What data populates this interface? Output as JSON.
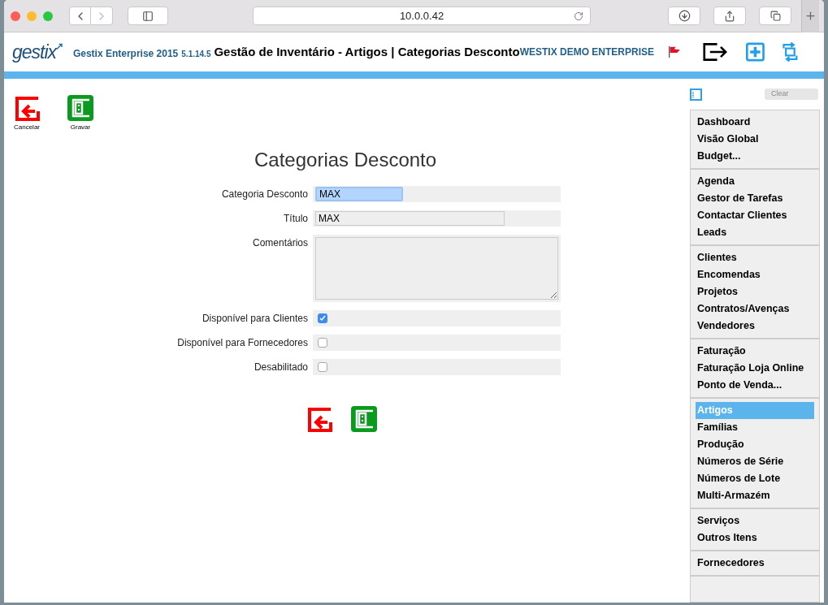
{
  "browser": {
    "url": "10.0.0.42"
  },
  "header": {
    "logo": "gestix",
    "product": "Gestix Enterprise 2015",
    "version": "5.1.14.5",
    "title": "Gestão de Inventário - Artigos | Categorias Desconto",
    "company": "WESTIX DEMO ENTERPRISE"
  },
  "actions": [
    {
      "kind": "cancel",
      "label": "Cancelar"
    },
    {
      "kind": "save",
      "label": "Gravar"
    }
  ],
  "form": {
    "title": "Categorias Desconto",
    "fields": [
      {
        "kind": "text",
        "label": "Categoria Desconto",
        "value": "MAX",
        "focused": true
      },
      {
        "kind": "text",
        "label": "Título",
        "value": "MAX",
        "focused": false
      },
      {
        "kind": "textarea",
        "label": "Comentários"
      },
      {
        "kind": "checkbox",
        "label": "Disponível para Clientes",
        "checked": true
      },
      {
        "kind": "checkbox",
        "label": "Disponível para Fornecedores",
        "checked": false
      },
      {
        "kind": "checkbox",
        "label": "Desabilitado",
        "checked": false
      }
    ],
    "bottom_actions": [
      {
        "kind": "cancel"
      },
      {
        "kind": "save"
      }
    ]
  },
  "sidebar": {
    "filter": "Clear",
    "groups": [
      [
        {
          "label": "Dashboard",
          "selected": false
        },
        {
          "label": "Visão Global",
          "selected": false
        },
        {
          "label": "Budget...",
          "selected": false
        }
      ],
      [
        {
          "label": "Agenda",
          "selected": false
        },
        {
          "label": "Gestor de Tarefas",
          "selected": false
        },
        {
          "label": "Contactar Clientes",
          "selected": false
        },
        {
          "label": "Leads",
          "selected": false
        }
      ],
      [
        {
          "label": "Clientes",
          "selected": false
        },
        {
          "label": "Encomendas",
          "selected": false
        },
        {
          "label": "Projetos",
          "selected": false
        },
        {
          "label": "Contratos/Avenças",
          "selected": false
        },
        {
          "label": "Vendedores",
          "selected": false
        }
      ],
      [
        {
          "label": "Faturação",
          "selected": false
        },
        {
          "label": "Faturação Loja Online",
          "selected": false
        },
        {
          "label": "Ponto de Venda...",
          "selected": false
        }
      ],
      [
        {
          "label": "Artigos",
          "selected": true
        },
        {
          "label": "Famílias",
          "selected": false
        },
        {
          "label": "Produção",
          "selected": false
        },
        {
          "label": "Números de Série",
          "selected": false
        },
        {
          "label": "Números de Lote",
          "selected": false
        },
        {
          "label": "Multi-Armazém",
          "selected": false
        }
      ],
      [
        {
          "label": "Serviços",
          "selected": false
        },
        {
          "label": "Outros Itens",
          "selected": false
        }
      ],
      [
        {
          "label": "Fornecedores",
          "selected": false
        }
      ]
    ]
  }
}
